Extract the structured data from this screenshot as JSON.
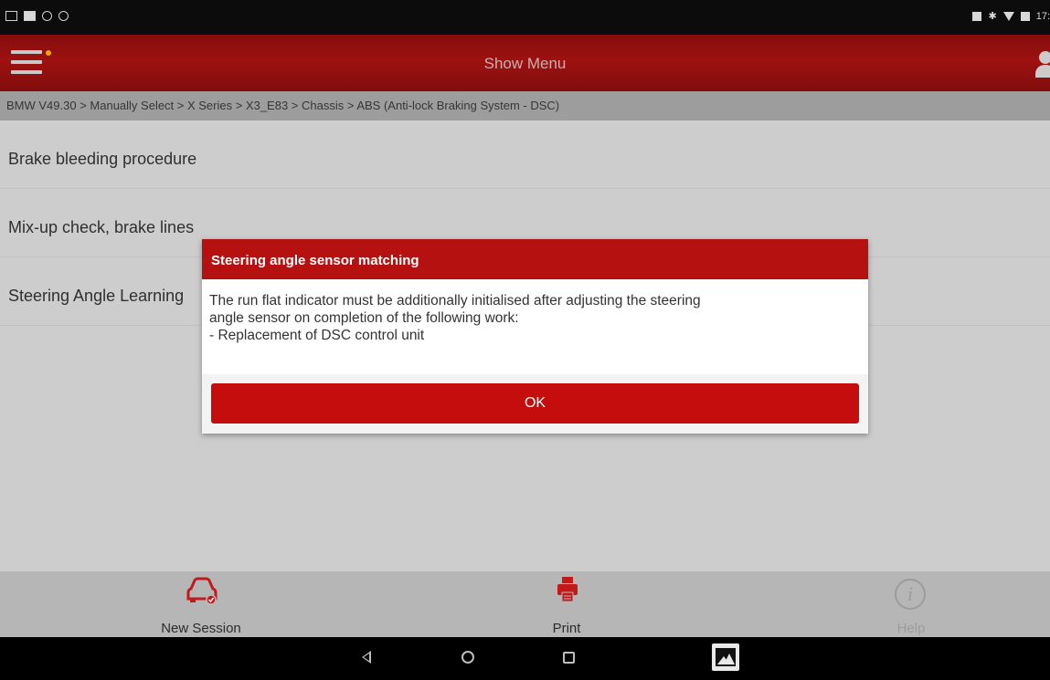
{
  "statusbar": {
    "left_icons": [
      "screenshot-icon",
      "square-icon",
      "app-icon",
      "app-icon"
    ],
    "right_icons": [
      "vibrate-icon",
      "bluetooth-icon",
      "wifi-icon",
      "battery-icon"
    ],
    "time": "17:"
  },
  "appbar": {
    "title": "Show Menu",
    "menu_icon": "hamburger-icon",
    "user_icon": "user-icon",
    "accent": "#a81313"
  },
  "breadcrumb": "BMW V49.30 > Manually Select > X Series > X3_E83 > Chassis > ABS (Anti-lock Braking System - DSC)",
  "menu_items": [
    {
      "label": "Brake bleeding procedure"
    },
    {
      "label": "Mix-up check, brake lines"
    },
    {
      "label": "Steering Angle Learning"
    }
  ],
  "dialog": {
    "title": "Steering angle sensor matching",
    "lines": [
      "The run flat indicator must be additionally initialised after adjusting the steering",
      "angle sensor on completion of the following work:",
      "- Replacement of DSC control unit"
    ],
    "ok_label": "OK",
    "accent": "#c50d0d"
  },
  "bottombar": {
    "tabs": [
      {
        "label": "New Session",
        "icon": "car-icon",
        "enabled": true
      },
      {
        "label": "Print",
        "icon": "printer-icon",
        "enabled": true
      },
      {
        "label": "Help",
        "icon": "info-icon",
        "enabled": false
      }
    ]
  },
  "navbar": {
    "icons": [
      "back-icon",
      "home-icon",
      "recents-icon",
      "gallery-icon"
    ]
  }
}
